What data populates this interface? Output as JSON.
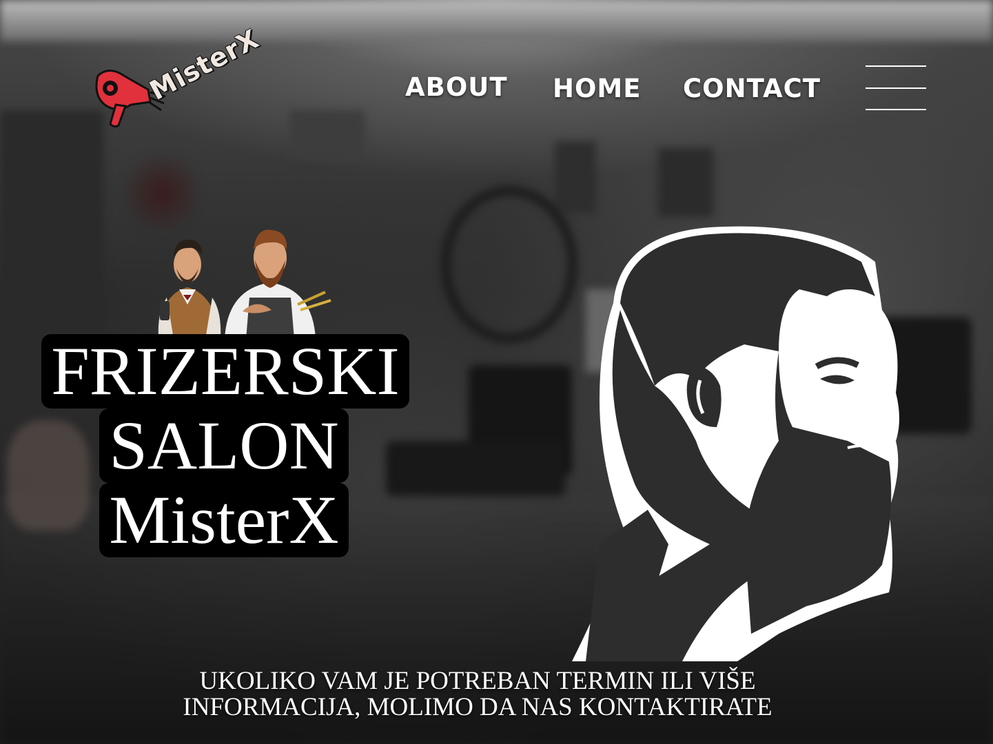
{
  "brand": {
    "logo_text": "MisterX",
    "logo_icon": "hair-dryer-icon"
  },
  "nav": {
    "items": [
      {
        "label": "ABOUT"
      },
      {
        "label": "HOME"
      },
      {
        "label": "CONTACT"
      }
    ],
    "menu_icon": "hamburger-menu-icon"
  },
  "hero": {
    "title_lines": [
      "FRIZERSKI",
      "SALON",
      "MisterX"
    ],
    "cta_lines": [
      "UKOLIKO VAM JE POTREBAN TERMIN ILI VIŠE",
      "INFORMACIJA, MOLIMO DA NAS KONTAKTIRATE"
    ]
  },
  "colors": {
    "logo_red": "#e0313c",
    "text": "#ffffff",
    "title_bg": "#000000"
  }
}
